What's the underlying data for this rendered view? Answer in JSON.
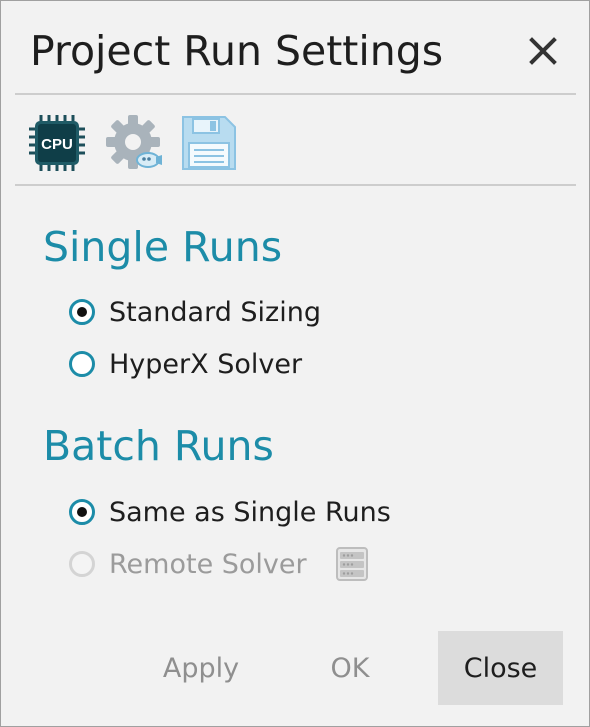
{
  "dialog": {
    "title": "Project Run Settings",
    "close_icon": "close-icon"
  },
  "toolbar": {
    "icons": [
      "cpu-icon",
      "gear-settings-icon",
      "save-icon"
    ],
    "cpu_label": "CPU"
  },
  "single_runs": {
    "heading": "Single Runs",
    "options": [
      {
        "label": "Standard Sizing",
        "selected": true,
        "enabled": true
      },
      {
        "label": "HyperX Solver",
        "selected": false,
        "enabled": true
      }
    ]
  },
  "batch_runs": {
    "heading": "Batch Runs",
    "options": [
      {
        "label": "Same as Single Runs",
        "selected": true,
        "enabled": true
      },
      {
        "label": "Remote Solver",
        "selected": false,
        "enabled": false,
        "icon": "server-icon"
      }
    ]
  },
  "buttons": {
    "apply": "Apply",
    "ok": "OK",
    "close": "Close"
  },
  "colors": {
    "accent": "#1c8ca8",
    "background": "#f2f2f2",
    "disabled_text": "#9b9b9b",
    "primary_button_bg": "#dcdcdc"
  }
}
